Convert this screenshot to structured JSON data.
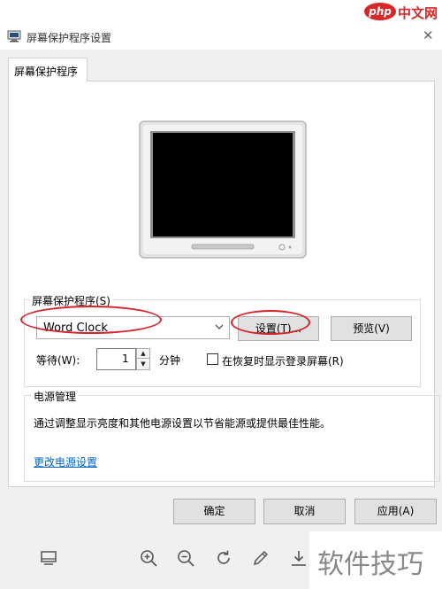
{
  "window": {
    "title": "屏幕保护程序设置",
    "close_glyph": "✕"
  },
  "tab": {
    "label": "屏幕保护程序"
  },
  "screensaver": {
    "legend": "屏幕保护程序(S)",
    "selected": "Word Clock",
    "settings_label": "设置(T)...",
    "preview_label": "预览(V)",
    "wait_label": "等待(W):",
    "wait_value": "1",
    "wait_unit": "分钟",
    "resume_label": "在恢复时显示登录屏幕(R)",
    "resume_checked": false
  },
  "power": {
    "legend": "电源管理",
    "description": "通过调整显示亮度和其他电源设置以节省能源或提供最佳性能。",
    "link": "更改电源设置"
  },
  "buttons": {
    "ok": "确定",
    "cancel": "取消",
    "apply": "应用(A)"
  },
  "viewer_toolbar": {
    "icons": [
      "fit-screen-icon",
      "zoom-in-icon",
      "zoom-out-icon",
      "rotate-icon",
      "edit-icon",
      "download-icon"
    ]
  },
  "watermarks": {
    "top_logo": "php",
    "top_text": "中文网",
    "bottom_text": "软件技巧"
  },
  "colors": {
    "annotation": "#d4232a",
    "link": "#0066cc",
    "dialog_bg": "#f0f0f0"
  }
}
